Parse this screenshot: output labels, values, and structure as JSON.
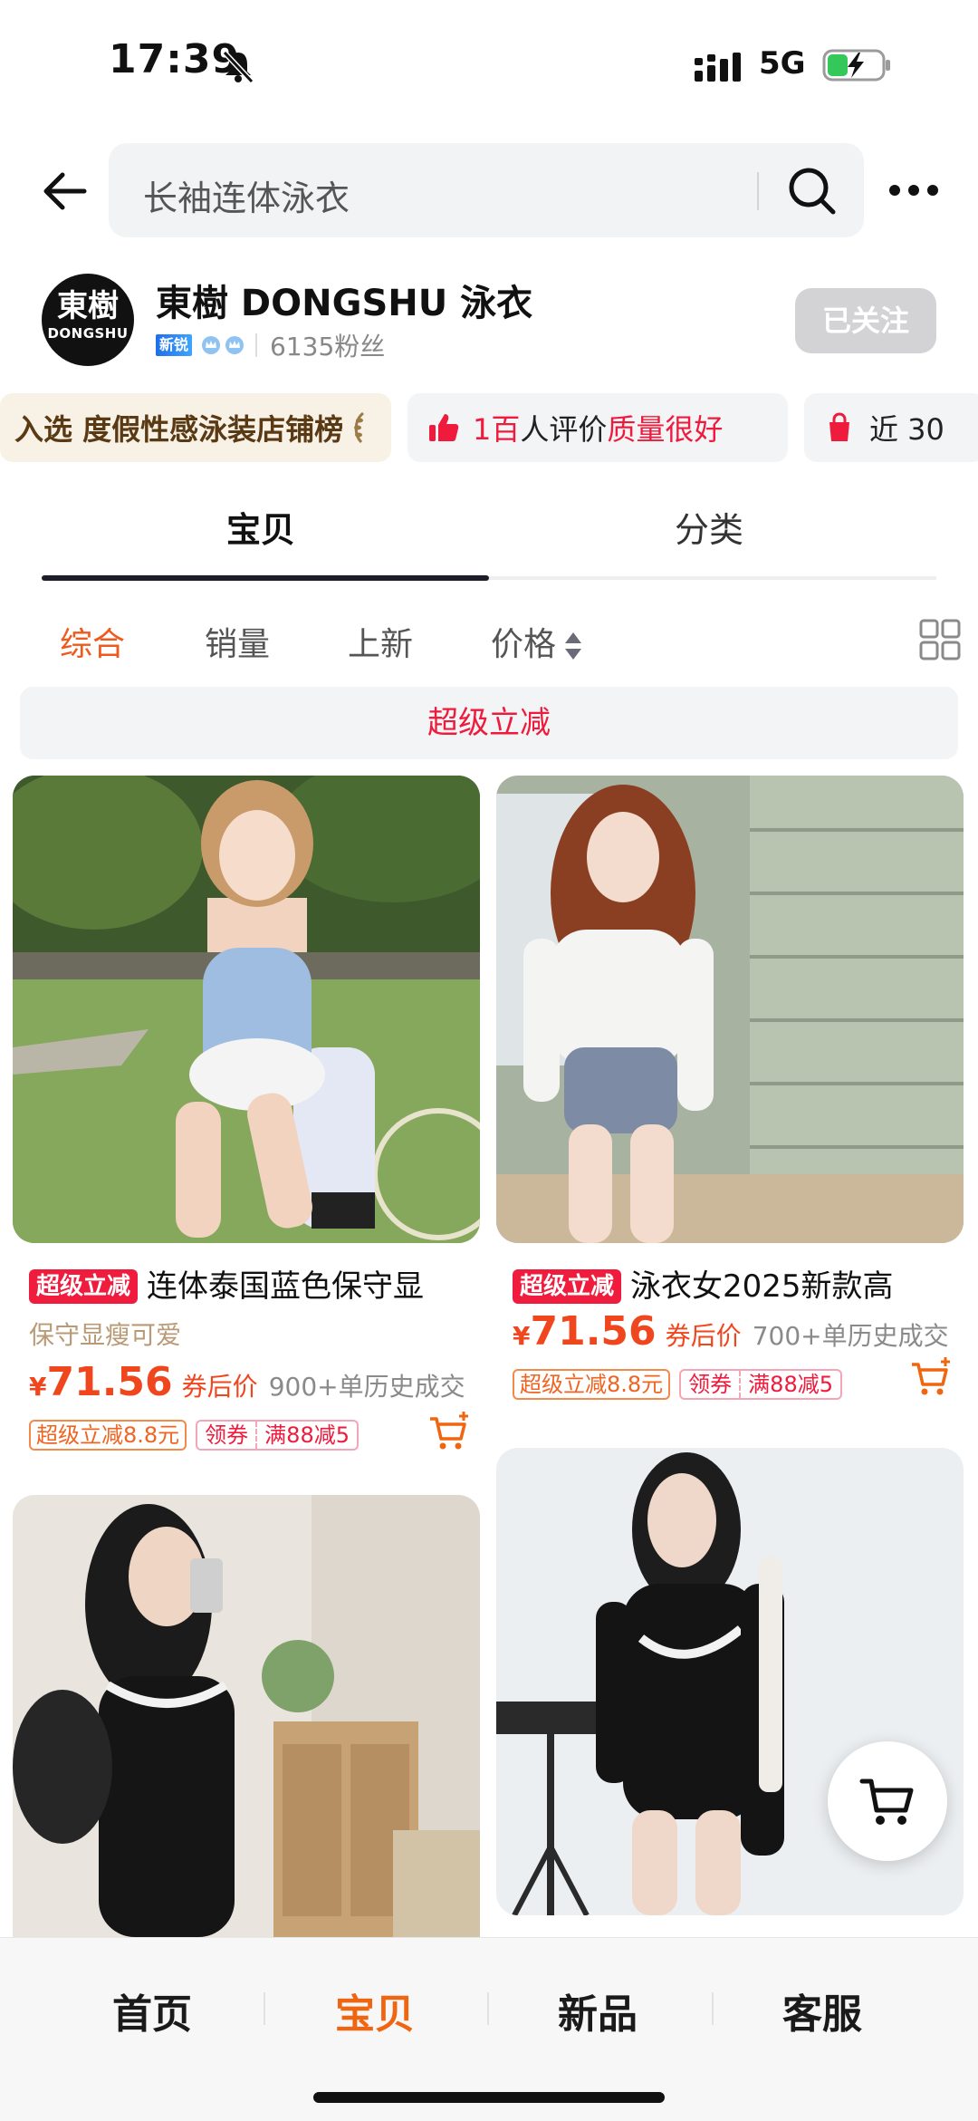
{
  "status_bar": {
    "time": "17:39",
    "network": "5G"
  },
  "search": {
    "query": "长袖连体泳衣"
  },
  "store": {
    "logo_line1": "東樹",
    "logo_line2": "DONGSHU",
    "name": "東樹 DONGSHU 泳衣",
    "level_badge": "新锐",
    "fans": "6135粉丝",
    "follow_label": "已关注"
  },
  "chips": {
    "rank_text": "入选 度假性感泳装店铺榜",
    "review_prefix": "1百",
    "review_middle": "人评价",
    "review_highlight": "质量很好",
    "recent_text": "近 30"
  },
  "tabs": [
    {
      "label": "宝贝",
      "active": true
    },
    {
      "label": "分类",
      "active": false
    }
  ],
  "sort": [
    {
      "label": "综合",
      "active": true
    },
    {
      "label": "销量",
      "active": false
    },
    {
      "label": "上新",
      "active": false
    },
    {
      "label": "价格",
      "active": false
    }
  ],
  "promo_banner": "超级立减",
  "products": [
    {
      "tag": "超级立减",
      "title": "连体泰国蓝色保守显",
      "subtitle": "保守显瘦可爱",
      "yen": "¥",
      "price": "71.56",
      "price_note": "券后价",
      "sold": "900+单历史成交",
      "coupon_discount": "超级立减8.8元",
      "coupon_claim": "领券",
      "coupon_rule": "满88减5"
    },
    {
      "tag": "超级立减",
      "title": "泳衣女2025新款高",
      "yen": "¥",
      "price": "71.56",
      "price_note": "券后价",
      "sold": "700+单历史成交",
      "coupon_discount": "超级立减8.8元",
      "coupon_claim": "领券",
      "coupon_rule": "满88减5"
    }
  ],
  "bottom_nav": [
    {
      "label": "首页",
      "active": false
    },
    {
      "label": "宝贝",
      "active": true
    },
    {
      "label": "新品",
      "active": false
    },
    {
      "label": "客服",
      "active": false
    }
  ],
  "colors": {
    "accent": "#f0650f",
    "promo_red": "#ee1b3d",
    "price_orange": "#f0461e"
  }
}
